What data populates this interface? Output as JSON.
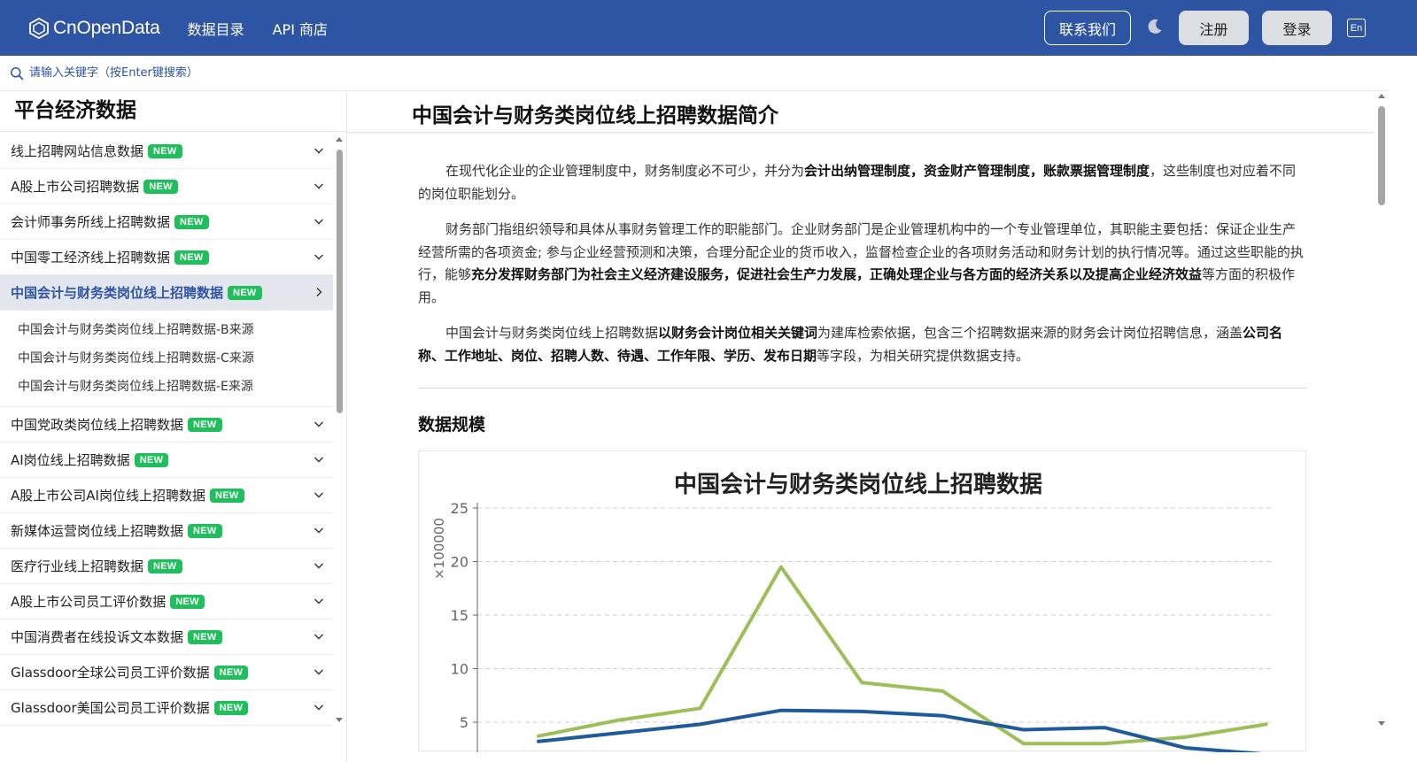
{
  "header": {
    "logo_text": "CnOpenData",
    "nav": [
      "数据目录",
      "API 商店"
    ],
    "contact_label": "联系我们",
    "register_label": "注册",
    "login_label": "登录",
    "lang_label": "En",
    "bg_color": "#2e55a3"
  },
  "search": {
    "placeholder": "请输入关键字（按Enter键搜索）"
  },
  "sidebar": {
    "title": "平台经济数据",
    "badge_text": "NEW",
    "items_before": [
      "线上招聘网站信息数据",
      "A股上市公司招聘数据",
      "会计师事务所线上招聘数据",
      "中国零工经济线上招聘数据"
    ],
    "active_item": "中国会计与财务类岗位线上招聘数据",
    "sub_items": [
      "中国会计与财务类岗位线上招聘数据-B来源",
      "中国会计与财务类岗位线上招聘数据-C来源",
      "中国会计与财务类岗位线上招聘数据-E来源"
    ],
    "items_after": [
      "中国党政类岗位线上招聘数据",
      "AI岗位线上招聘数据",
      "A股上市公司AI岗位线上招聘数据",
      "新媒体运营岗位线上招聘数据",
      "医疗行业线上招聘数据",
      "A股上市公司员工评价数据",
      "中国消费者在线投诉文本数据",
      "Glassdoor全球公司员工评价数据",
      "Glassdoor美国公司员工评价数据"
    ]
  },
  "main": {
    "title": "中国会计与财务类岗位线上招聘数据简介",
    "para1": [
      {
        "t": "在现代化企业的企业管理制度中，财务制度必不可少，并分为",
        "b": false
      },
      {
        "t": "会计出纳管理制度，资金财产管理制度，账款票据管理制度",
        "b": true
      },
      {
        "t": "，这些制度也对应着不同的岗位职能划分。",
        "b": false
      }
    ],
    "para2": [
      {
        "t": "财务部门指组织领导和具体从事财务管理工作的职能部门。企业财务部门是企业管理机构中的一个专业管理单位，其职能主要包括：保证企业生产经营所需的各项资金; 参与企业经营预测和决策，合理分配企业的货币收入，监督检查企业的各项财务活动和财务计划的执行情况等。通过这些职能的执行，能够",
        "b": false
      },
      {
        "t": "充分发挥财务部门为社会主义经济建设服务，促进社会生产力发展，正确处理企业与各方面的经济关系以及提高企业经济效益",
        "b": true
      },
      {
        "t": "等方面的积极作用。",
        "b": false
      }
    ],
    "para3": [
      {
        "t": "中国会计与财务类岗位线上招聘数据",
        "b": false
      },
      {
        "t": "以财务会计岗位相关关键词",
        "b": true
      },
      {
        "t": "为建库检索依据，包含三个招聘数据来源的财务会计岗位招聘信息，涵盖",
        "b": false
      },
      {
        "t": "公司名称、工作地址、岗位、招聘人数、待遇、工作年限、学历、发布日期",
        "b": true
      },
      {
        "t": "等字段，为相关研究提供数据支持。",
        "b": false
      }
    ],
    "section_title": "数据规模"
  },
  "chart_data": {
    "type": "line",
    "title": "中国会计与财务类岗位线上招聘数据",
    "ylabel": "×100000",
    "ylim": [
      3.5,
      25
    ],
    "yticks": [
      5,
      10,
      15,
      20,
      25
    ],
    "grid": true,
    "series": [
      {
        "color": "#9cbf57",
        "values": [
          3.7,
          5.2,
          6.3,
          19.5,
          8.7,
          7.9,
          3.0,
          3.0,
          3.6,
          4.8
        ]
      },
      {
        "color": "#1f5a9c",
        "values": [
          3.2,
          4.0,
          4.8,
          6.1,
          6.0,
          5.6,
          4.3,
          4.5,
          2.6,
          2.0
        ]
      }
    ]
  }
}
